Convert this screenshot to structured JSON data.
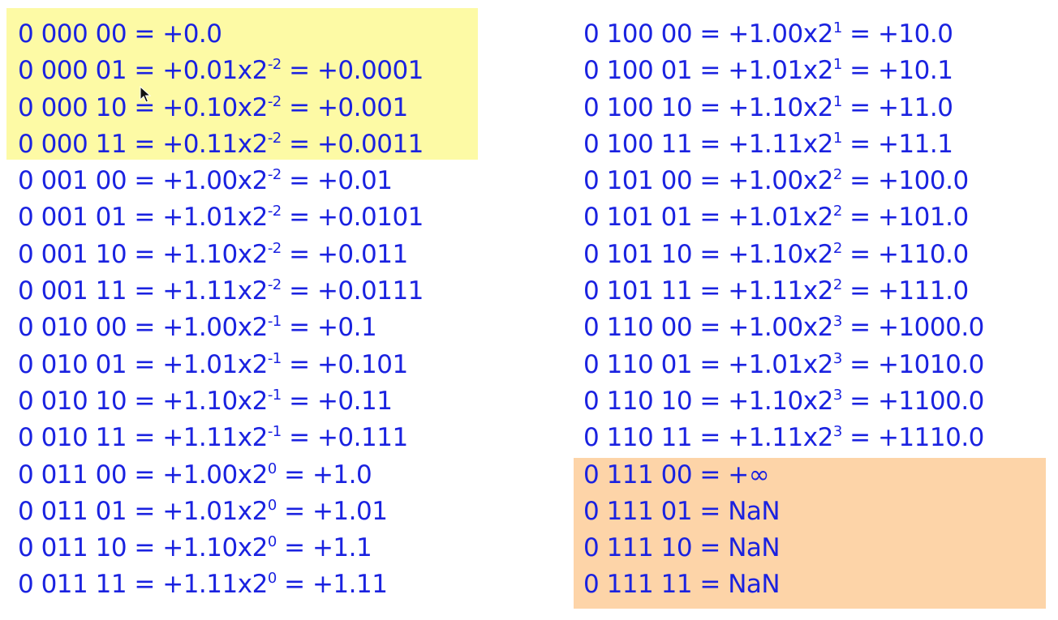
{
  "colors": {
    "text": "#1a22e0",
    "denormal_highlight": "#fdfaa5",
    "special_highlight": "#fdd4a8"
  },
  "left_rows": [
    {
      "bits": "0 000 00",
      "sig": "+0.0",
      "exp": "",
      "val": ""
    },
    {
      "bits": "0 000 01",
      "sig": "+0.01x2",
      "exp": "-2",
      "val": "+0.0001"
    },
    {
      "bits": "0 000 10",
      "sig": "+0.10x2",
      "exp": "-2",
      "val": "+0.001"
    },
    {
      "bits": "0 000 11",
      "sig": "+0.11x2",
      "exp": "-2",
      "val": "+0.0011"
    },
    {
      "bits": "0 001 00",
      "sig": "+1.00x2",
      "exp": "-2",
      "val": "+0.01"
    },
    {
      "bits": "0 001 01",
      "sig": "+1.01x2",
      "exp": "-2",
      "val": "+0.0101"
    },
    {
      "bits": "0 001 10",
      "sig": "+1.10x2",
      "exp": "-2",
      "val": "+0.011"
    },
    {
      "bits": "0 001 11",
      "sig": "+1.11x2",
      "exp": "-2",
      "val": "+0.0111"
    },
    {
      "bits": "0 010 00",
      "sig": "+1.00x2",
      "exp": "-1",
      "val": "+0.1"
    },
    {
      "bits": "0 010 01",
      "sig": "+1.01x2",
      "exp": "-1",
      "val": "+0.101"
    },
    {
      "bits": "0 010 10",
      "sig": "+1.10x2",
      "exp": "-1",
      "val": "+0.11"
    },
    {
      "bits": "0 010 11",
      "sig": "+1.11x2",
      "exp": "-1",
      "val": "+0.111"
    },
    {
      "bits": "0 011 00",
      "sig": "+1.00x2",
      "exp": "0",
      "val": "+1.0"
    },
    {
      "bits": "0 011 01",
      "sig": "+1.01x2",
      "exp": "0",
      "val": "+1.01"
    },
    {
      "bits": "0 011 10",
      "sig": "+1.10x2",
      "exp": "0",
      "val": "+1.1"
    },
    {
      "bits": "0 011 11",
      "sig": "+1.11x2",
      "exp": "0",
      "val": "+1.11"
    }
  ],
  "right_rows": [
    {
      "bits": "0 100 00",
      "sig": "+1.00x2",
      "exp": "1",
      "val": "+10.0"
    },
    {
      "bits": "0 100 01",
      "sig": "+1.01x2",
      "exp": "1",
      "val": "+10.1"
    },
    {
      "bits": "0 100 10",
      "sig": "+1.10x2",
      "exp": "1",
      "val": "+11.0"
    },
    {
      "bits": "0 100 11",
      "sig": "+1.11x2",
      "exp": "1",
      "val": "+11.1"
    },
    {
      "bits": "0 101 00",
      "sig": "+1.00x2",
      "exp": "2",
      "val": "+100.0"
    },
    {
      "bits": "0 101 01",
      "sig": "+1.01x2",
      "exp": "2",
      "val": "+101.0"
    },
    {
      "bits": "0 101 10",
      "sig": "+1.10x2",
      "exp": "2",
      "val": "+110.0"
    },
    {
      "bits": "0 101 11",
      "sig": "+1.11x2",
      "exp": "2",
      "val": "+111.0"
    },
    {
      "bits": "0 110 00",
      "sig": "+1.00x2",
      "exp": "3",
      "val": "+1000.0"
    },
    {
      "bits": "0 110 01",
      "sig": "+1.01x2",
      "exp": "3",
      "val": "+1010.0"
    },
    {
      "bits": "0 110 10",
      "sig": "+1.10x2",
      "exp": "3",
      "val": "+1100.0"
    },
    {
      "bits": "0 110 11",
      "sig": "+1.11x2",
      "exp": "3",
      "val": "+1110.0"
    },
    {
      "bits": "0 111 00",
      "sig": "+∞",
      "exp": "",
      "val": ""
    },
    {
      "bits": "0 111 01",
      "sig": "NaN",
      "exp": "",
      "val": ""
    },
    {
      "bits": "0 111 10",
      "sig": "NaN",
      "exp": "",
      "val": ""
    },
    {
      "bits": "0 111 11",
      "sig": "NaN",
      "exp": "",
      "val": ""
    }
  ]
}
